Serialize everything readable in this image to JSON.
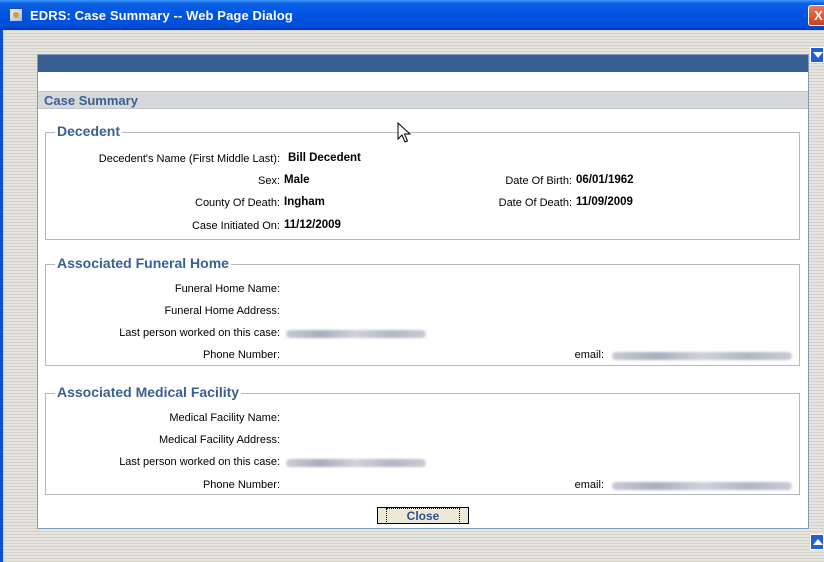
{
  "window": {
    "title": "EDRS: Case Summary -- Web Page Dialog",
    "close_glyph": "X"
  },
  "panel": {
    "section_title": "Case Summary"
  },
  "decedent": {
    "legend": "Decedent",
    "name_label": "Decedent's Name (First Middle Last):",
    "name_value": "Bill Decedent",
    "sex_label": "Sex:",
    "sex_value": "Male",
    "county_label": "County Of Death:",
    "county_value": "Ingham",
    "initiated_label": "Case Initiated On:",
    "initiated_value": "11/12/2009",
    "dob_label": "Date Of Birth:",
    "dob_value": "06/01/1962",
    "dod_label": "Date Of Death:",
    "dod_value": "11/09/2009"
  },
  "funeral_home": {
    "legend": "Associated Funeral Home",
    "name_label": "Funeral Home Name:",
    "address_label": "Funeral Home Address:",
    "last_person_label": "Last person worked on this case:",
    "phone_label": "Phone Number:",
    "email_label": "email:"
  },
  "medical_facility": {
    "legend": "Associated Medical Facility",
    "name_label": "Medical Facility Name:",
    "address_label": "Medical Facility Address:",
    "last_person_label": "Last person worked on this case:",
    "phone_label": "Phone Number:",
    "email_label": "email:"
  },
  "actions": {
    "close_label": "Close"
  },
  "colors": {
    "title_bar": "#0054e3",
    "panel_bar": "#395f92",
    "section_text": "#3a5f93"
  },
  "icons": [
    "window-icon",
    "close-icon",
    "scroll-up-icon",
    "scroll-down-icon",
    "mouse-cursor-icon"
  ]
}
